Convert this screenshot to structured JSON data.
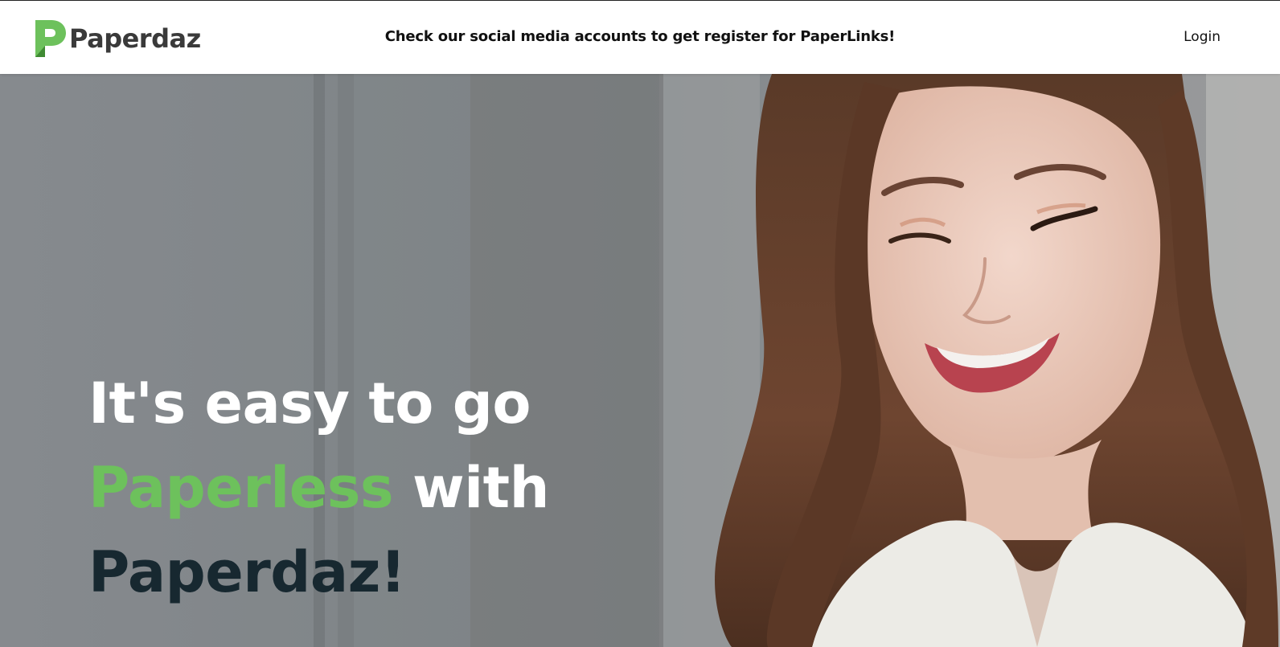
{
  "header": {
    "logo_text": "Paperdaz",
    "announcement": "Check our social media accounts to get register for PaperLinks!",
    "login_label": "Login"
  },
  "hero": {
    "headline_line1": "It's easy to go",
    "headline_highlight": "Paperless",
    "headline_line2_rest": " with",
    "headline_line3": "Paperdaz!",
    "image_icon": "woman-smiling-photo"
  },
  "colors": {
    "brand_green": "#6dc15c",
    "headline_dark": "#172830",
    "headline_white": "#ffffff"
  }
}
